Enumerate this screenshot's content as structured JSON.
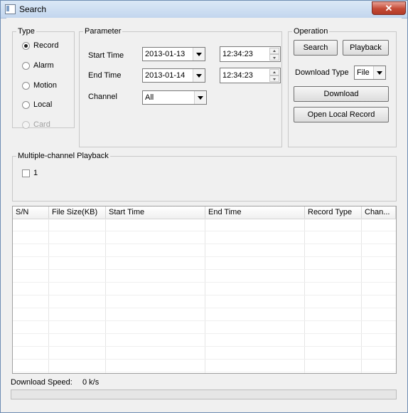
{
  "window": {
    "title": "Search",
    "close_symbol": "✕"
  },
  "type_group": {
    "legend": "Type",
    "options": [
      {
        "label": "Record",
        "checked": true,
        "disabled": false
      },
      {
        "label": "Alarm",
        "checked": false,
        "disabled": false
      },
      {
        "label": "Motion",
        "checked": false,
        "disabled": false
      },
      {
        "label": "Local",
        "checked": false,
        "disabled": false
      },
      {
        "label": "Card",
        "checked": false,
        "disabled": true
      }
    ]
  },
  "parameter_group": {
    "legend": "Parameter",
    "start_time_label": "Start Time",
    "start_date": "2013-01-13",
    "start_time": "12:34:23",
    "end_time_label": "End Time",
    "end_date": "2013-01-14",
    "end_time": "12:34:23",
    "channel_label": "Channel",
    "channel_value": "All"
  },
  "operation_group": {
    "legend": "Operation",
    "search_button": "Search",
    "playback_button": "Playback",
    "download_type_label": "Download Type",
    "download_type_value": "File",
    "download_button": "Download",
    "open_local_button": "Open Local Record"
  },
  "multi_channel_group": {
    "legend": "Multiple-channel Playback",
    "channels": [
      {
        "label": "1",
        "checked": false
      }
    ]
  },
  "results_table": {
    "columns": [
      "S/N",
      "File Size(KB)",
      "Start Time",
      "End Time",
      "Record Type",
      "Chan..."
    ],
    "rows": []
  },
  "footer": {
    "download_speed_label": "Download Speed:",
    "download_speed_value": "0 k/s",
    "progress": 0
  }
}
